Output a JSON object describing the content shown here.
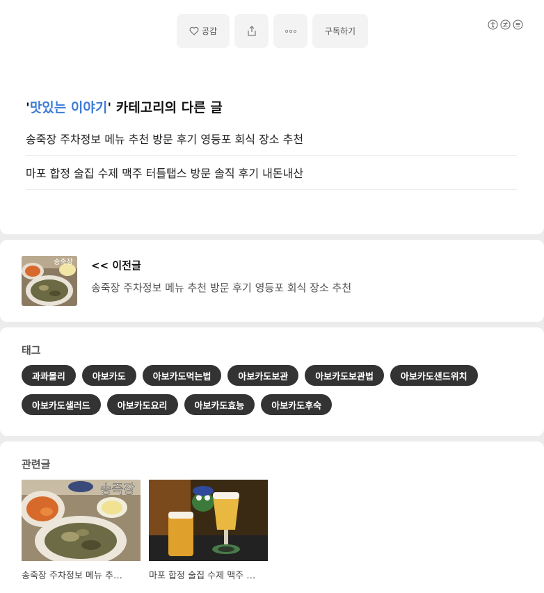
{
  "actions": {
    "like_label": "공감",
    "subscribe_label": "구독하기"
  },
  "util_icons": [
    "accessibility-icon",
    "block-icon",
    "menu-icon"
  ],
  "category": {
    "quote_open": "'",
    "name": "맛있는 이야기",
    "heading_rest": "' 카테고리의 다른 글",
    "posts": [
      "송죽장 주차정보 메뉴 추천 방문 후기 영등포 회식 장소 추천",
      "마포 합정 술집 수제 맥주 터틀탭스 방문 솔직 후기 내돈내산"
    ]
  },
  "prev_post": {
    "label": "<< 이전글",
    "title": "송죽장 주차정보 메뉴 추천 방문 후기 영등포 회식 장소 추천",
    "thumb_text": "송죽장"
  },
  "tags": {
    "title": "태그",
    "items": [
      "과콰몰리",
      "아보카도",
      "아보카도먹는법",
      "아보카도보관",
      "아보카도보관법",
      "아보카도샌드위치",
      "아보카도샐러드",
      "아보카도요리",
      "아보카도효능",
      "아보카도후숙"
    ]
  },
  "related": {
    "title": "관련글",
    "thumb_text": "송죽장",
    "items": [
      "송죽장 주차정보 메뉴 추…",
      "마포 합정 술집 수제 맥주 …"
    ]
  },
  "colors": {
    "accent": "#3d7bd8",
    "tag_bg": "#333333",
    "page_bg": "#ececec"
  }
}
